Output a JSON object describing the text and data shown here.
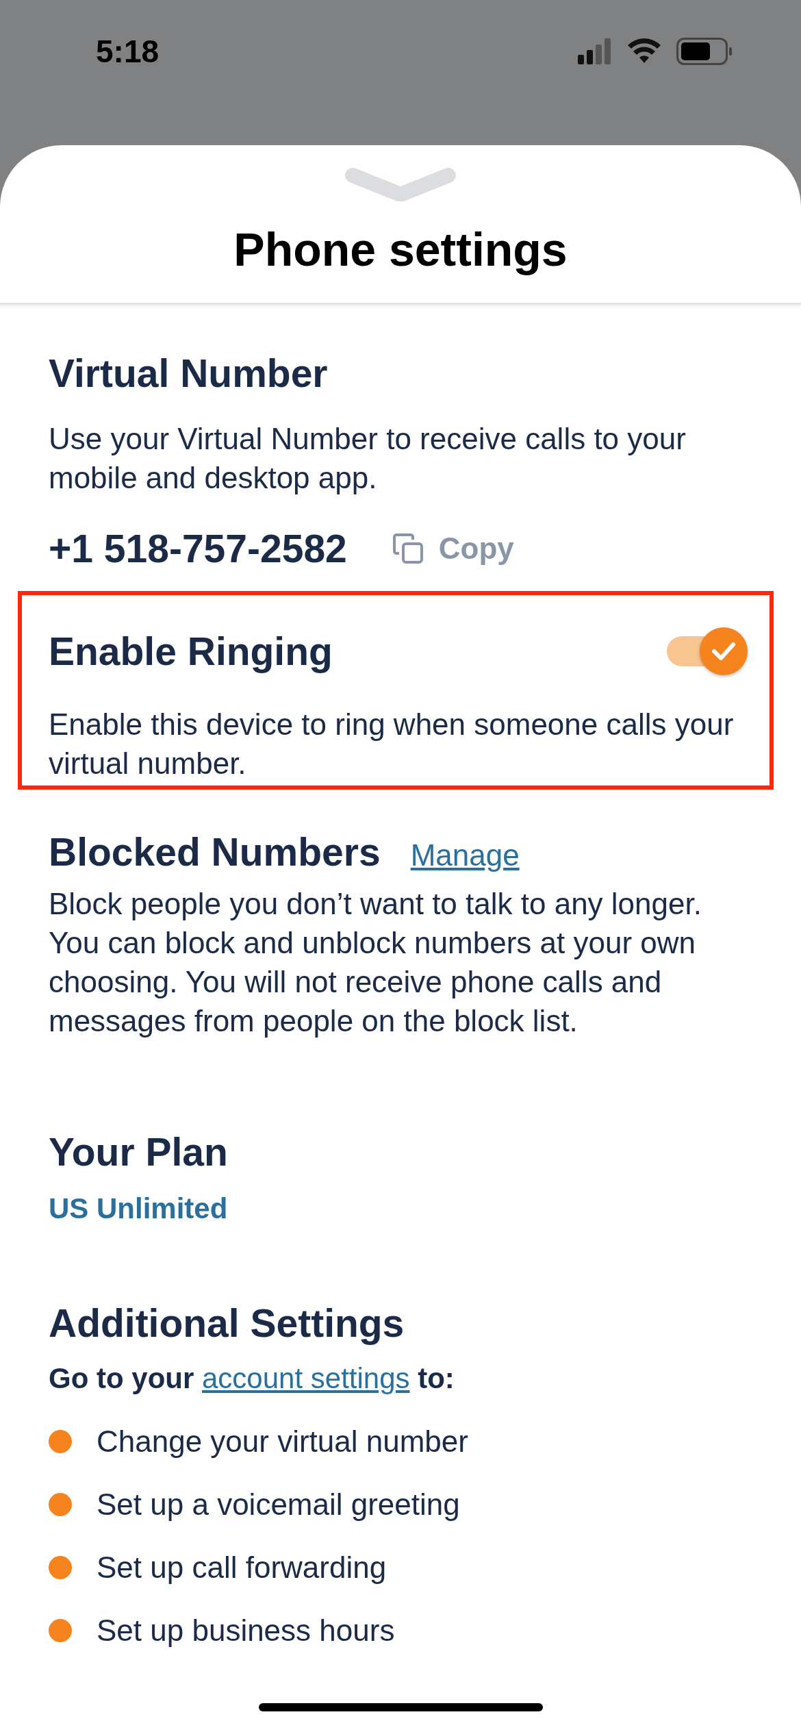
{
  "status_bar": {
    "time": "5:18"
  },
  "sheet": {
    "title": "Phone settings"
  },
  "virtual_number": {
    "heading": "Virtual Number",
    "description": "Use your Virtual Number to receive calls to your mobile and desktop app.",
    "number": "+1 518-757-2582",
    "copy_label": "Copy"
  },
  "enable_ringing": {
    "heading": "Enable Ringing",
    "description": "Enable this device to ring when someone calls your virtual number.",
    "on": true,
    "highlighted": true
  },
  "blocked_numbers": {
    "heading": "Blocked Numbers",
    "link": "Manage",
    "description": "Block people you don’t want to talk to any longer. You can block and unblock numbers at your own choosing. You will not receive phone calls and messages from people on the block list."
  },
  "plan": {
    "heading": "Your Plan",
    "name": "US Unlimited"
  },
  "additional_settings": {
    "heading": "Additional Settings",
    "intro_start": "Go to your ",
    "link": "account settings",
    "intro_end": " to:",
    "items": [
      {
        "label": "Change your virtual number"
      },
      {
        "label": "Set up a voicemail greeting"
      },
      {
        "label": "Set up call forwarding"
      },
      {
        "label": "Set up business hours"
      }
    ]
  }
}
